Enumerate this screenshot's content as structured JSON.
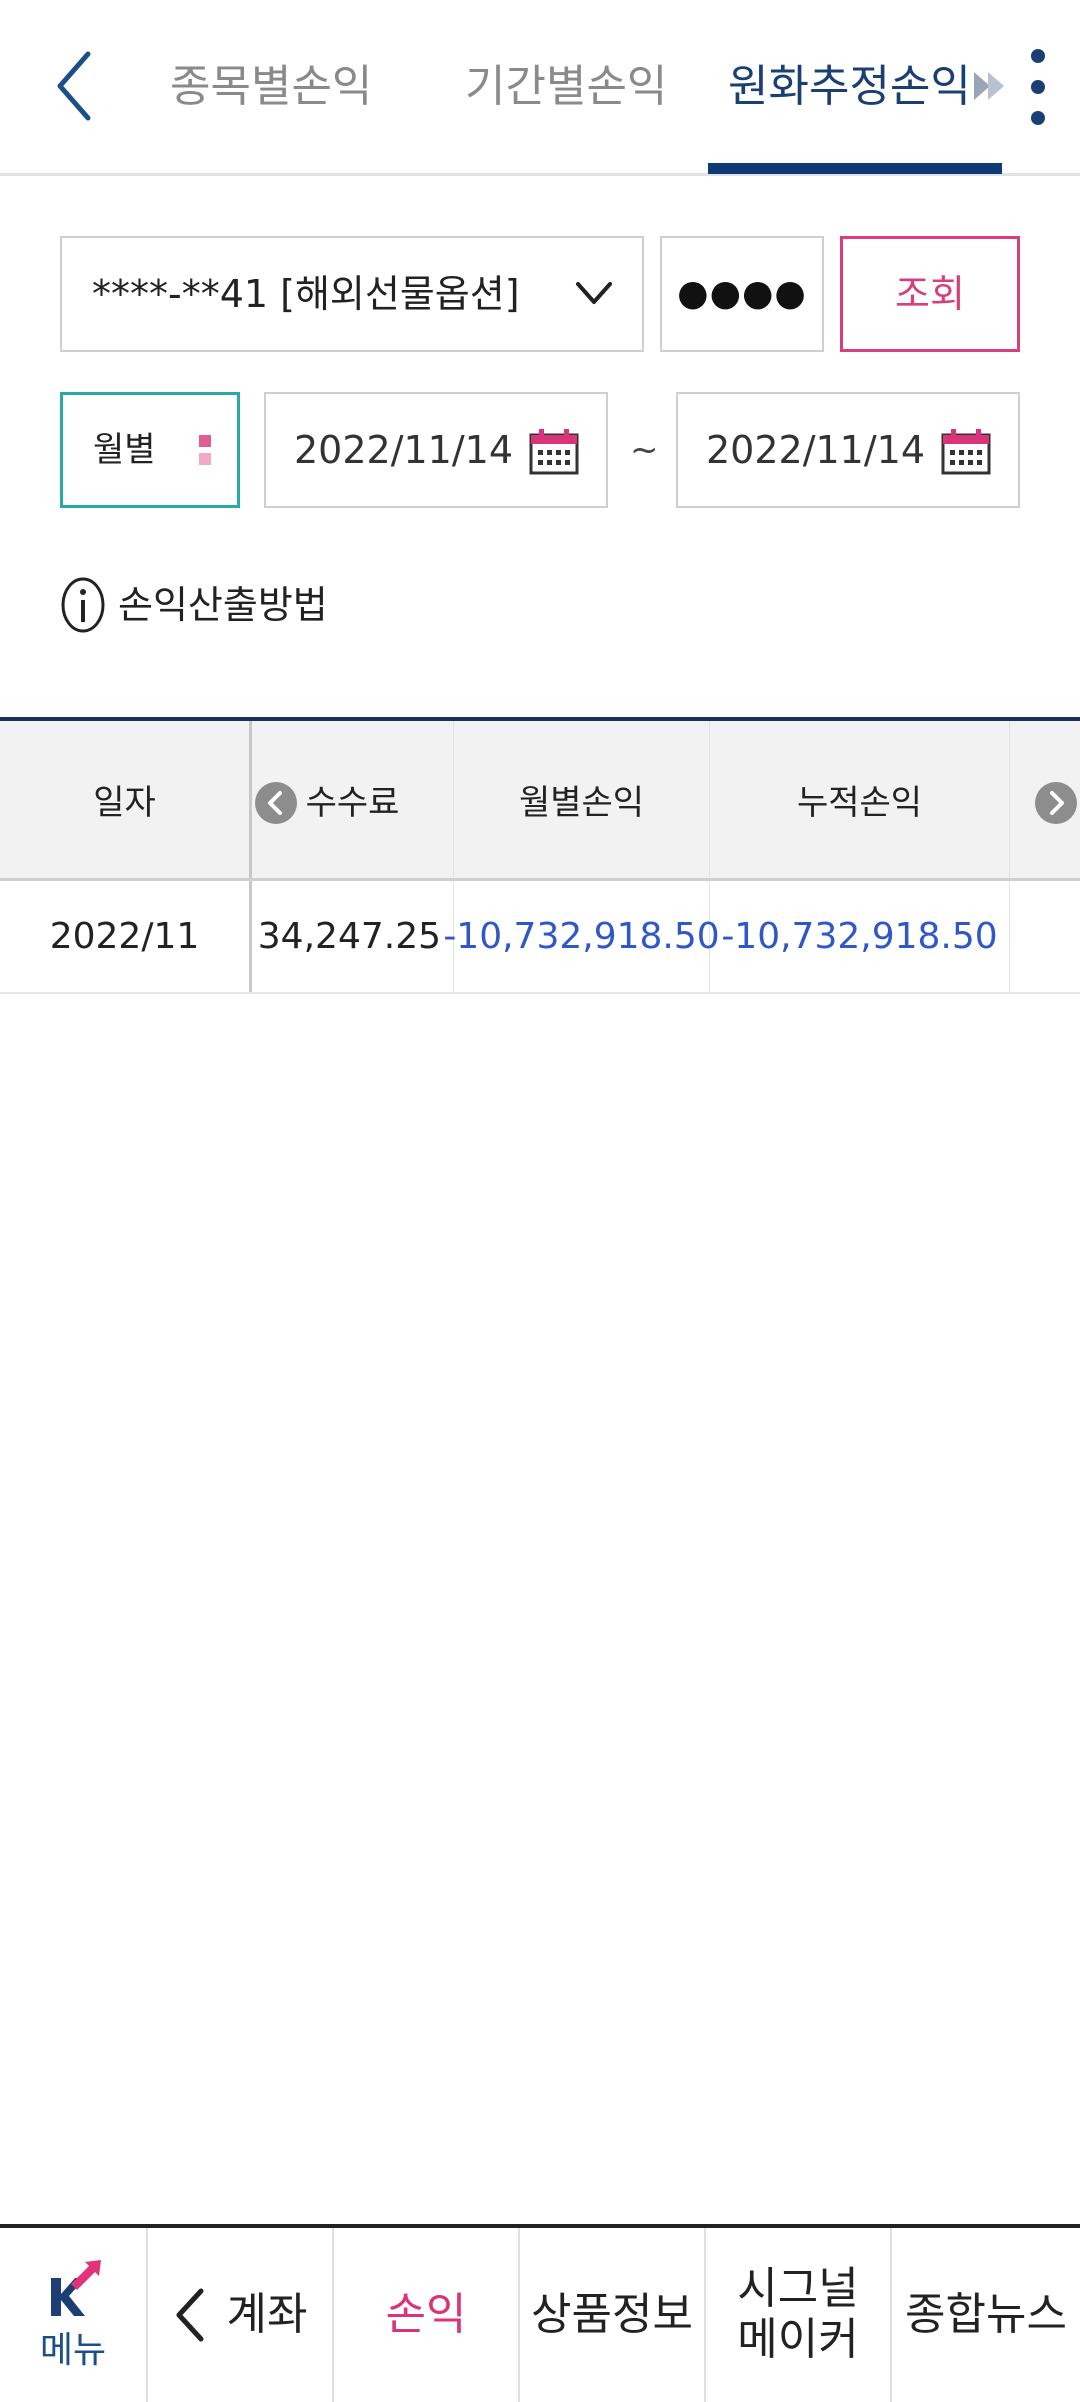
{
  "header": {
    "tabs": [
      {
        "label": "종목별손익"
      },
      {
        "label": "기간별손익"
      },
      {
        "label": "원화추정손익",
        "active": true
      }
    ],
    "back_icon": "chevron-left-icon",
    "more_icon": "kebab-menu-icon"
  },
  "search": {
    "account": "****-**41 [해외선물옵션]",
    "password_mask": "●●●●",
    "query_label": "조회"
  },
  "period": {
    "mode": "월별",
    "start_date": "2022/11/14",
    "separator": "~",
    "end_date": "2022/11/14"
  },
  "info": {
    "label": "손익산출방법"
  },
  "table": {
    "columns": [
      "일자",
      "수수료",
      "월별손익",
      "누적손익"
    ],
    "rows": [
      {
        "date": "2022/11",
        "fee": "34,247.25",
        "monthly": "-10,732,918.50",
        "cumulative": "-10,732,918.50"
      }
    ]
  },
  "bottom_nav": {
    "menu": "메뉴",
    "account": "계좌",
    "pnl": "손익",
    "product": "상품정보",
    "signal_line1": "시그널",
    "signal_line2": "메이커",
    "news": "종합뉴스"
  },
  "colors": {
    "accent_pink": "#d93e7c",
    "navy": "#0e3a78",
    "teal": "#2aa8a6",
    "negative_blue": "#2f57c7"
  }
}
